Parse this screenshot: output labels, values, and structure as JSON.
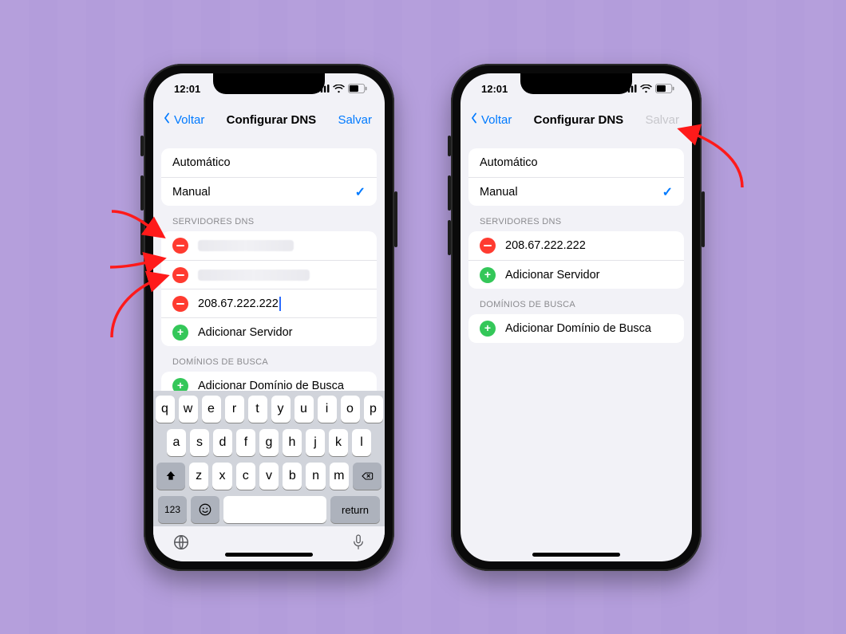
{
  "status": {
    "time": "12:01"
  },
  "nav": {
    "back_label": "Voltar",
    "title": "Configurar DNS",
    "save_label": "Salvar"
  },
  "mode_group": {
    "automatic": "Automático",
    "manual": "Manual"
  },
  "dns": {
    "header": "SERVIDORES DNS",
    "add_server": "Adicionar Servidor",
    "entry_ip": "208.67.222.222"
  },
  "search_domains": {
    "header": "DOMÍNIOS DE BUSCA",
    "add_domain": "Adicionar Domínio de Busca"
  },
  "keyboard": {
    "row1": [
      "q",
      "w",
      "e",
      "r",
      "t",
      "y",
      "u",
      "i",
      "o",
      "p"
    ],
    "row2": [
      "a",
      "s",
      "d",
      "f",
      "g",
      "h",
      "j",
      "k",
      "l"
    ],
    "row3": [
      "z",
      "x",
      "c",
      "v",
      "b",
      "n",
      "m"
    ],
    "numeric_label": "123",
    "return_label": "return"
  },
  "colors": {
    "ios_blue": "#007aff",
    "ios_red": "#ff3b30",
    "ios_green": "#34c759",
    "annotation_red": "#ff1a1a",
    "bg_purple": "#b39ddb"
  }
}
